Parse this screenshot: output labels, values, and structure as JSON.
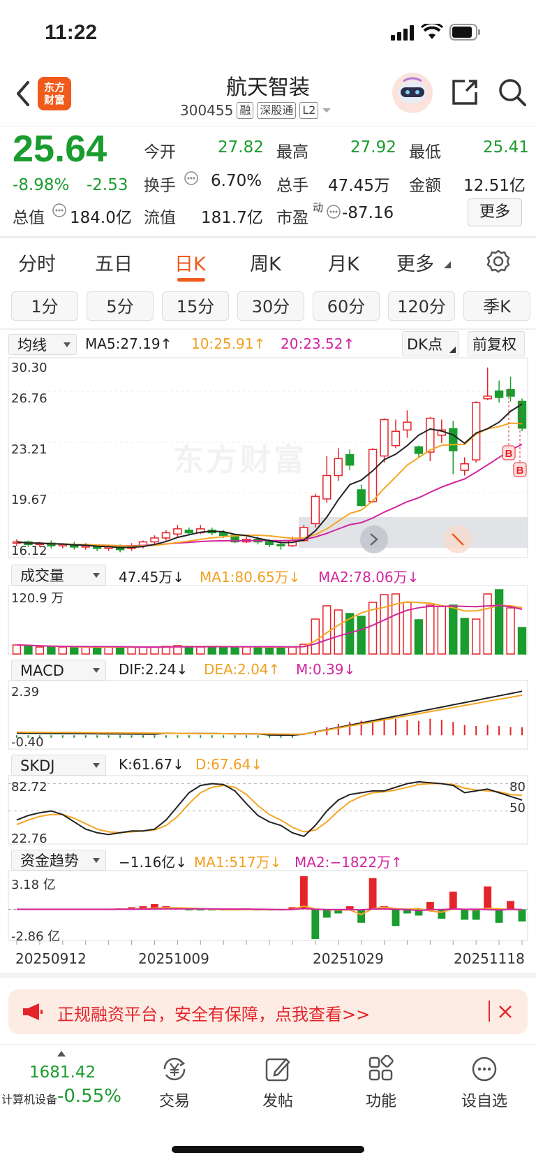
{
  "status_bar": {
    "time": "11:22"
  },
  "header": {
    "logo_line1": "东方",
    "logo_line2": "财富",
    "stock_name": "航天智装",
    "stock_code": "300455",
    "tags": [
      "融",
      "深股通",
      "L2"
    ]
  },
  "quote": {
    "price": "25.64",
    "change_pct": "-8.98%",
    "change": "-2.53",
    "open_label": "今开",
    "open": "27.82",
    "high_label": "最高",
    "high": "27.92",
    "low_label": "最低",
    "low": "25.41",
    "turnover_label": "换手",
    "turnover": "6.70%",
    "volume_label": "总手",
    "volume": "47.45万",
    "amount_label": "金额",
    "amount": "12.51亿",
    "mktcap_label": "总值",
    "mktcap": "184.0亿",
    "float_label": "流值",
    "float_cap": "181.7亿",
    "pe_label": "市盈",
    "pe_sup": "动",
    "pe": "-87.16",
    "more_label": "更多"
  },
  "period_tabs": [
    "分时",
    "五日",
    "日K",
    "周K",
    "月K",
    "更多"
  ],
  "active_tab": "日K",
  "interval_buttons": [
    "1分",
    "5分",
    "15分",
    "30分",
    "60分",
    "120分",
    "季K"
  ],
  "kline_header": {
    "dropdown": "均线",
    "ma5": "MA5:27.19↑",
    "ma10": "10:25.91↑",
    "ma20": "20:23.52↑",
    "dk_button": "DK点",
    "adjust_button": "前复权"
  },
  "colors": {
    "up": "#e5242a",
    "down": "#1a9c2e",
    "ma5": "#222222",
    "ma10": "#f5a623",
    "ma20": "#d2259f",
    "accent": "#f05a1a"
  },
  "volume_header": {
    "dropdown": "成交量",
    "vol": "47.45万↓",
    "ma1": "MA1:80.65万↓",
    "ma2": "MA2:78.06万↓",
    "axis_top": "120.9 万"
  },
  "macd_header": {
    "dropdown": "MACD",
    "dif": "DIF:2.24↓",
    "dea": "DEA:2.04↑",
    "m": "M:0.39↓",
    "axis_top": "2.39",
    "axis_bottom": "-0.40"
  },
  "skdj_header": {
    "dropdown": "SKDJ",
    "k": "K:61.67↓",
    "d": "D:67.64↓",
    "axis_top": "82.72",
    "axis_bottom": "22.76",
    "level_80": "80",
    "level_50": "50"
  },
  "flow_header": {
    "dropdown": "资金趋势",
    "val": "−1.16亿↓",
    "ma1": "MA1:517万↓",
    "ma2": "MA2:−1822万↑",
    "axis_top": "3.18 亿",
    "axis_bottom": "-2.86 亿"
  },
  "dates": [
    "20250912",
    "20251009",
    "20251029",
    "20251118"
  ],
  "watermark": "东方财富",
  "banner": {
    "text": "正规融资平台，安全有保障，点我查看>>"
  },
  "bottom_bar": {
    "index_value": "1681.42",
    "index_name": "计算机设备",
    "index_change": "-0.55%",
    "items": [
      "交易",
      "发帖",
      "功能",
      "设自选"
    ]
  },
  "chart_data": {
    "type": "candlestick",
    "price_axis_labels": [
      "30.30",
      "26.76",
      "23.21",
      "19.67",
      "16.12"
    ],
    "ylim": [
      16.12,
      30.3
    ],
    "candles": [
      [
        16.8,
        16.9,
        17.1,
        16.6
      ],
      [
        16.9,
        16.7,
        17.0,
        16.5
      ],
      [
        16.7,
        16.8,
        16.9,
        16.5
      ],
      [
        16.8,
        16.6,
        17.0,
        16.4
      ],
      [
        16.6,
        16.7,
        16.8,
        16.4
      ],
      [
        16.7,
        16.5,
        16.9,
        16.3
      ],
      [
        16.5,
        16.6,
        16.8,
        16.3
      ],
      [
        16.6,
        16.4,
        16.7,
        16.2
      ],
      [
        16.4,
        16.5,
        16.6,
        16.2
      ],
      [
        16.5,
        16.3,
        16.7,
        16.1
      ],
      [
        16.4,
        16.6,
        16.8,
        16.2
      ],
      [
        16.6,
        16.9,
        17.0,
        16.4
      ],
      [
        16.9,
        17.2,
        17.4,
        16.7
      ],
      [
        17.2,
        17.6,
        17.8,
        17.0
      ],
      [
        17.5,
        17.9,
        18.2,
        17.3
      ],
      [
        17.8,
        17.6,
        18.0,
        17.4
      ],
      [
        17.6,
        17.9,
        18.2,
        17.5
      ],
      [
        17.8,
        17.6,
        18.0,
        17.4
      ],
      [
        17.6,
        17.4,
        17.8,
        17.2
      ],
      [
        17.4,
        16.9,
        17.5,
        16.8
      ],
      [
        16.9,
        17.1,
        17.3,
        16.8
      ],
      [
        17.1,
        16.9,
        17.3,
        16.7
      ],
      [
        16.9,
        16.7,
        17.1,
        16.5
      ],
      [
        16.7,
        16.6,
        17.0,
        16.3
      ],
      [
        16.6,
        17.0,
        17.3,
        16.5
      ],
      [
        17.0,
        18.0,
        18.2,
        16.9
      ],
      [
        18.3,
        20.4,
        20.6,
        18.0
      ],
      [
        20.2,
        22.0,
        23.5,
        19.9
      ],
      [
        22.0,
        23.3,
        24.1,
        21.6
      ],
      [
        23.6,
        22.8,
        24.0,
        22.4
      ],
      [
        20.9,
        19.7,
        21.3,
        19.6
      ],
      [
        20.0,
        24.0,
        24.1,
        19.9
      ],
      [
        23.5,
        26.3,
        26.4,
        23.0
      ],
      [
        24.3,
        25.4,
        26.3,
        24.1
      ],
      [
        25.5,
        26.1,
        27.0,
        24.9
      ],
      [
        24.2,
        23.7,
        24.3,
        23.4
      ],
      [
        23.8,
        26.4,
        26.5,
        23.1
      ],
      [
        25.1,
        25.5,
        26.3,
        24.5
      ],
      [
        25.6,
        23.9,
        26.2,
        22.1
      ],
      [
        22.4,
        22.9,
        23.4,
        22.0
      ],
      [
        23.2,
        27.6,
        27.7,
        23.0
      ],
      [
        27.9,
        28.1,
        30.3,
        27.8
      ],
      [
        28.5,
        28.0,
        29.3,
        27.6
      ],
      [
        28.6,
        28.1,
        29.6,
        27.7
      ],
      [
        27.7,
        25.64,
        27.92,
        25.41
      ]
    ],
    "markers": [
      "B",
      "B"
    ],
    "volume_axis_top": "120.9 万",
    "volume": [
      13,
      12,
      10,
      10,
      10,
      10,
      10,
      10,
      10,
      10,
      10,
      10,
      10,
      11,
      12,
      11,
      10,
      11,
      10,
      10,
      10,
      10,
      10,
      10,
      10,
      14,
      50,
      69,
      63,
      58,
      54,
      74,
      85,
      86,
      74,
      49,
      70,
      68,
      70,
      51,
      50,
      86,
      92,
      66,
      38
    ],
    "volume_up": [
      1,
      0,
      1,
      0,
      1,
      0,
      1,
      0,
      1,
      0,
      1,
      1,
      1,
      1,
      1,
      0,
      1,
      0,
      0,
      0,
      1,
      0,
      0,
      0,
      1,
      1,
      1,
      1,
      1,
      0,
      0,
      1,
      1,
      1,
      1,
      0,
      1,
      1,
      0,
      0,
      1,
      1,
      0,
      1,
      0
    ],
    "macd_bars": [
      0,
      0,
      0,
      0,
      0,
      0,
      0,
      0,
      0,
      0,
      0,
      0,
      0,
      0,
      0,
      0,
      0,
      0,
      0,
      0,
      0,
      0,
      0,
      0,
      0,
      0.05,
      0.2,
      0.4,
      0.55,
      0.65,
      0.7,
      0.75,
      0.8,
      0.8,
      0.75,
      0.7,
      0.8,
      0.75,
      0.65,
      0.5,
      0.45,
      0.5,
      0.45,
      0.4,
      0.39
    ],
    "flow_bars": [
      0,
      0,
      0,
      0,
      0,
      0,
      0,
      0,
      0,
      0.1,
      0.2,
      0.3,
      0.5,
      0.3,
      0.1,
      -0.1,
      -0.1,
      -0.1,
      -0.1,
      -0.1,
      0.1,
      -0.1,
      -0.1,
      -0.1,
      0.2,
      3.18,
      -2.86,
      -0.8,
      -0.4,
      0.3,
      -1.3,
      3.0,
      0.3,
      -1.6,
      -0.4,
      -0.6,
      0.7,
      -0.9,
      1.7,
      -1.0,
      -1.0,
      2.2,
      -1.3,
      0.8,
      -1.16
    ],
    "x_labels": [
      "20250912",
      "20251009",
      "20251029",
      "20251118"
    ]
  }
}
